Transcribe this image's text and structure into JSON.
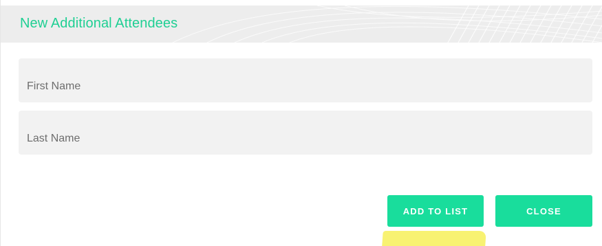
{
  "dialog": {
    "title": "New Additional Attendees"
  },
  "form": {
    "first_name": {
      "placeholder": "First Name",
      "value": ""
    },
    "last_name": {
      "placeholder": "Last Name",
      "value": ""
    }
  },
  "actions": {
    "add_label": "ADD TO LIST",
    "close_label": "CLOSE"
  },
  "colors": {
    "accent": "#19dd9c",
    "title": "#1fcf93",
    "field_bg": "#f2f2f2",
    "header_bg": "#ededed",
    "highlight": "#f8f16a"
  }
}
